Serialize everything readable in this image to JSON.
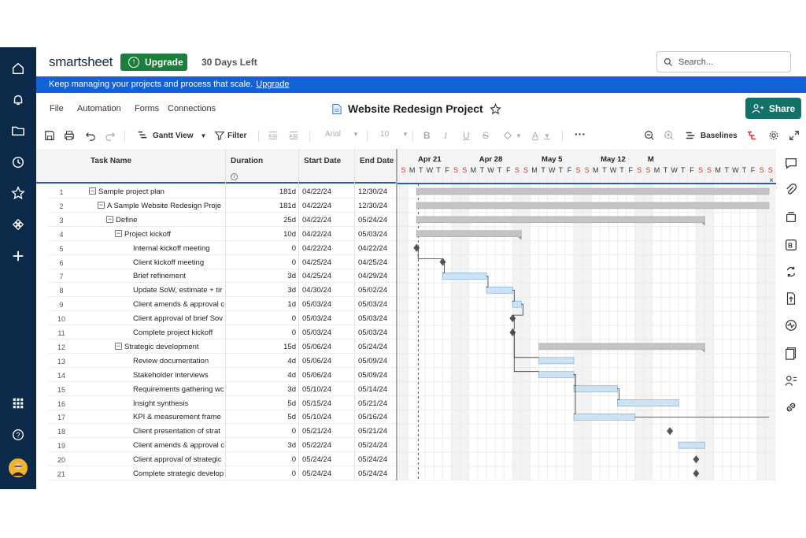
{
  "brand": {
    "logo": "smartsheet"
  },
  "header": {
    "upgrade_label": "Upgrade",
    "days_left": "30 Days Left",
    "search_placeholder": "Search..."
  },
  "banner": {
    "text": "Keep managing your projects and process that scale.",
    "link": "Upgrade"
  },
  "menu": {
    "file": "File",
    "automation": "Automation",
    "forms": "Forms",
    "connections": "Connections"
  },
  "sheet": {
    "title": "Website Redesign Project"
  },
  "share_label": "Share",
  "toolbar": {
    "view": "Gantt View",
    "filter": "Filter",
    "font": "Arial",
    "size": "10",
    "baselines": "Baselines"
  },
  "columns": {
    "task": "Task Name",
    "duration": "Duration",
    "start": "Start Date",
    "end": "End Date"
  },
  "rows": [
    {
      "n": "1",
      "name": "Sample project plan",
      "dur": "181d",
      "start": "04/22/24",
      "end": "12/30/24"
    },
    {
      "n": "2",
      "name": "A Sample Website Redesign Proje",
      "dur": "181d",
      "start": "04/22/24",
      "end": "12/30/24"
    },
    {
      "n": "3",
      "name": "Define",
      "dur": "25d",
      "start": "04/22/24",
      "end": "05/24/24"
    },
    {
      "n": "4",
      "name": "Project kickoff",
      "dur": "10d",
      "start": "04/22/24",
      "end": "05/03/24"
    },
    {
      "n": "5",
      "name": "Internal kickoff meeting",
      "dur": "0",
      "start": "04/22/24",
      "end": "04/22/24"
    },
    {
      "n": "6",
      "name": "Client kickoff meeting",
      "dur": "0",
      "start": "04/25/24",
      "end": "04/25/24"
    },
    {
      "n": "7",
      "name": "Brief refinement",
      "dur": "3d",
      "start": "04/25/24",
      "end": "04/29/24"
    },
    {
      "n": "8",
      "name": "Update SoW, estimate + tir",
      "dur": "3d",
      "start": "04/30/24",
      "end": "05/02/24"
    },
    {
      "n": "9",
      "name": "Client amends & approval c",
      "dur": "1d",
      "start": "05/03/24",
      "end": "05/03/24"
    },
    {
      "n": "10",
      "name": "Client approval of brief Sov",
      "dur": "0",
      "start": "05/03/24",
      "end": "05/03/24"
    },
    {
      "n": "11",
      "name": "Complete project kickoff",
      "dur": "0",
      "start": "05/03/24",
      "end": "05/03/24"
    },
    {
      "n": "12",
      "name": "Strategic development",
      "dur": "15d",
      "start": "05/06/24",
      "end": "05/24/24"
    },
    {
      "n": "13",
      "name": "Review documentation",
      "dur": "4d",
      "start": "05/06/24",
      "end": "05/09/24"
    },
    {
      "n": "14",
      "name": "Stakeholder interviews",
      "dur": "4d",
      "start": "05/06/24",
      "end": "05/09/24"
    },
    {
      "n": "15",
      "name": "Requirements gathering wc",
      "dur": "3d",
      "start": "05/10/24",
      "end": "05/14/24"
    },
    {
      "n": "16",
      "name": "Insight synthesis",
      "dur": "5d",
      "start": "05/15/24",
      "end": "05/21/24"
    },
    {
      "n": "17",
      "name": "KPI & measurement frame",
      "dur": "5d",
      "start": "05/10/24",
      "end": "05/16/24"
    },
    {
      "n": "18",
      "name": "Client presentation of strat",
      "dur": "0",
      "start": "05/21/24",
      "end": "05/21/24"
    },
    {
      "n": "19",
      "name": "Client amends & approval c",
      "dur": "3d",
      "start": "05/22/24",
      "end": "05/24/24"
    },
    {
      "n": "20",
      "name": "Client approval of strategic",
      "dur": "0",
      "start": "05/24/24",
      "end": "05/24/24"
    },
    {
      "n": "21",
      "name": "Complete strategic develop",
      "dur": "0",
      "start": "05/24/24",
      "end": "05/24/24"
    }
  ],
  "gantt": {
    "weeks": [
      "Apr 21",
      "Apr 28",
      "May 5",
      "May 12",
      "M"
    ],
    "day_letters": [
      "S",
      "M",
      "T",
      "W",
      "T",
      "F",
      "S"
    ],
    "colors": {
      "summary": "#c4c4c4",
      "task": "#cde3f5",
      "task_border": "#8bb8e0",
      "milestone": "#555555",
      "weekend": "#f3f3f3",
      "weekend_letter": "#d0342c"
    }
  }
}
